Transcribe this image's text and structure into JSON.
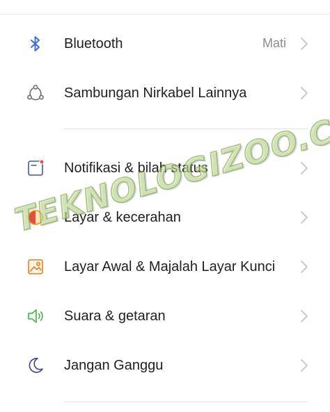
{
  "settings": {
    "items": [
      {
        "label": "Bluetooth",
        "value": "Mati",
        "icon": "bluetooth-icon",
        "chevron": true
      },
      {
        "label": "Sambungan Nirkabel Lainnya",
        "value": "",
        "icon": "wireless-connections-icon",
        "chevron": true
      },
      {
        "label": "Notifikasi & bilah status",
        "value": "",
        "icon": "notification-status-bar-icon",
        "chevron": true
      },
      {
        "label": "Layar & kecerahan",
        "value": "",
        "icon": "display-brightness-icon",
        "chevron": true
      },
      {
        "label": "Layar Awal & Majalah Layar Kunci",
        "value": "",
        "icon": "wallpaper-icon",
        "chevron": true
      },
      {
        "label": "Suara & getaran",
        "value": "",
        "icon": "sound-icon",
        "chevron": true
      },
      {
        "label": "Jangan Ganggu",
        "value": "",
        "icon": "moon-icon",
        "chevron": true
      }
    ]
  },
  "watermark": {
    "text": "TEKNOLOGIZOO.COM"
  },
  "colors": {
    "bluetooth": "#3b6fe0",
    "wireless": "#6b6b6b",
    "notification": "#3c5aa8",
    "notification_dot": "#e74c3c",
    "display": "#f39c12",
    "wallpaper": "#e67e22",
    "sound": "#4caf50",
    "moon": "#3f3f9a",
    "chevron": "#c4c4c4"
  }
}
